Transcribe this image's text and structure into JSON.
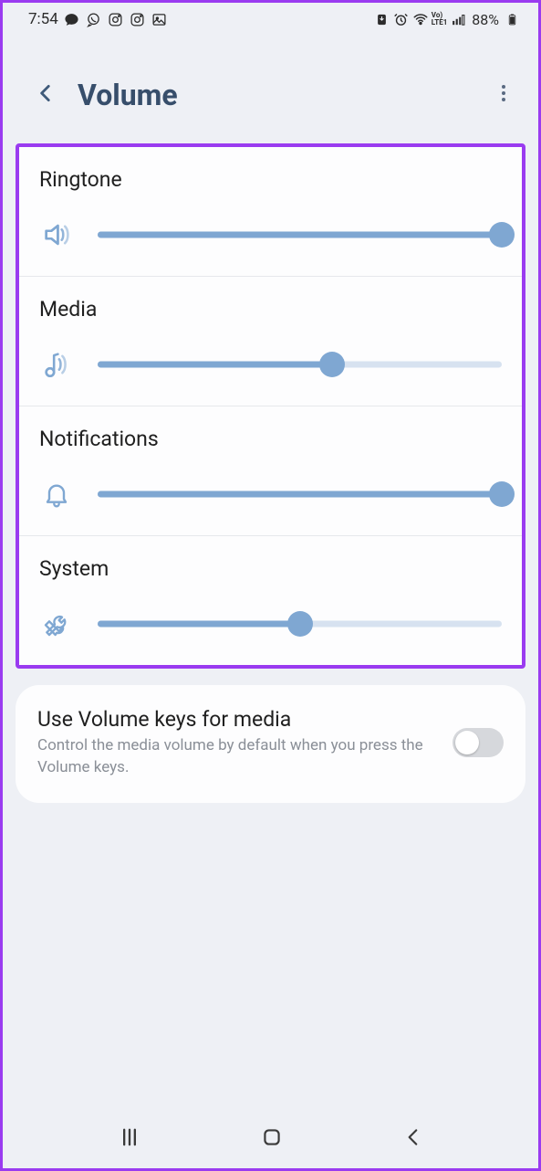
{
  "status": {
    "time": "7:54",
    "battery_percent": "88%"
  },
  "appbar": {
    "title": "Volume"
  },
  "sliders": [
    {
      "label": "Ringtone",
      "value": 100
    },
    {
      "label": "Media",
      "value": 58
    },
    {
      "label": "Notifications",
      "value": 100
    },
    {
      "label": "System",
      "value": 50
    }
  ],
  "option": {
    "title": "Use Volume keys for media",
    "subtitle": "Control the media volume by default when you press the Volume keys.",
    "enabled": false
  }
}
